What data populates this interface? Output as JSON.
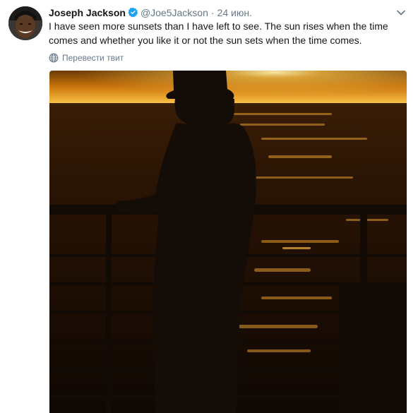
{
  "tweet": {
    "display_name": "Joseph Jackson",
    "handle": "@Joe5Jackson",
    "separator": "·",
    "time": "24 июн.",
    "text": "I have seen more sunsets than I have left to see. The sun rises when the time comes and whether you like it or not the sun sets when the time comes.",
    "translate_label": "Перевести твит",
    "verified_icon": "verified-badge-icon",
    "menu_icon": "chevron-down-icon"
  },
  "colors": {
    "name": "#14171a",
    "secondary": "#657786",
    "verified": "#1da1f2",
    "sunset_gold": "#e8a21c",
    "silhouette": "#140c06"
  }
}
